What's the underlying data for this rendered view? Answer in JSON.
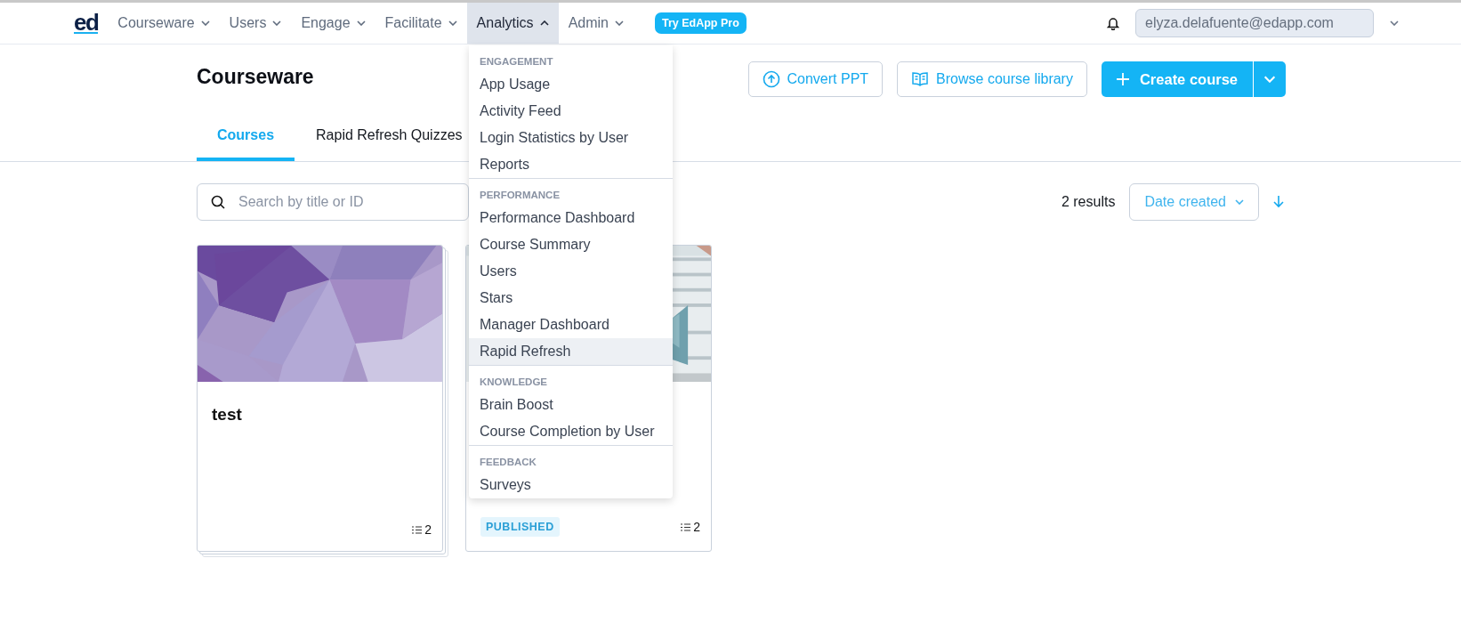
{
  "nav": {
    "logo": "ed",
    "items": [
      {
        "label": "Courseware",
        "selected": false,
        "expanded": false
      },
      {
        "label": "Users",
        "selected": false,
        "expanded": false
      },
      {
        "label": "Engage",
        "selected": false,
        "expanded": false
      },
      {
        "label": "Facilitate",
        "selected": false,
        "expanded": false
      },
      {
        "label": "Analytics",
        "selected": true,
        "expanded": true
      },
      {
        "label": "Admin",
        "selected": false,
        "expanded": false
      }
    ],
    "badge": "Try EdApp Pro",
    "account": "elyza.delafuente@edapp.com"
  },
  "page": {
    "title": "Courseware",
    "buttons": [
      {
        "label": "Convert PPT",
        "kind": "upload"
      },
      {
        "label": "Browse course library",
        "kind": "book"
      },
      {
        "label": "Create course",
        "kind": "primary"
      }
    ]
  },
  "tabs": [
    {
      "label": "Courses",
      "selected": true
    },
    {
      "label": "Rapid Refresh Quizzes",
      "selected": false
    }
  ],
  "search": {
    "placeholder": "Search by title or ID"
  },
  "results": "2 results",
  "sort": {
    "label": "Date created"
  },
  "cards": [
    {
      "title": "test",
      "lesson_count": "2",
      "stacked": true
    },
    {
      "status": "PUBLISHED",
      "lesson_count": "2",
      "stacked": false
    }
  ],
  "analytics_menu": {
    "sections": [
      {
        "heading": "ENGAGEMENT",
        "items": [
          {
            "label": "App Usage",
            "selected": false
          },
          {
            "label": "Activity Feed",
            "selected": false
          },
          {
            "label": "Login Statistics by User",
            "selected": false
          },
          {
            "label": "Reports",
            "selected": false
          }
        ]
      },
      {
        "heading": "PERFORMANCE",
        "items": [
          {
            "label": "Performance Dashboard",
            "selected": false
          },
          {
            "label": "Course Summary",
            "selected": false
          },
          {
            "label": "Users",
            "selected": false
          },
          {
            "label": "Stars",
            "selected": false
          },
          {
            "label": "Manager Dashboard",
            "selected": false
          },
          {
            "label": "Rapid Refresh",
            "selected": true
          }
        ]
      },
      {
        "heading": "KNOWLEDGE",
        "items": [
          {
            "label": "Brain Boost",
            "selected": false
          },
          {
            "label": "Course Completion by User",
            "selected": false
          }
        ]
      },
      {
        "heading": "FEEDBACK",
        "items": [
          {
            "label": "Surveys",
            "selected": false
          }
        ]
      }
    ]
  }
}
